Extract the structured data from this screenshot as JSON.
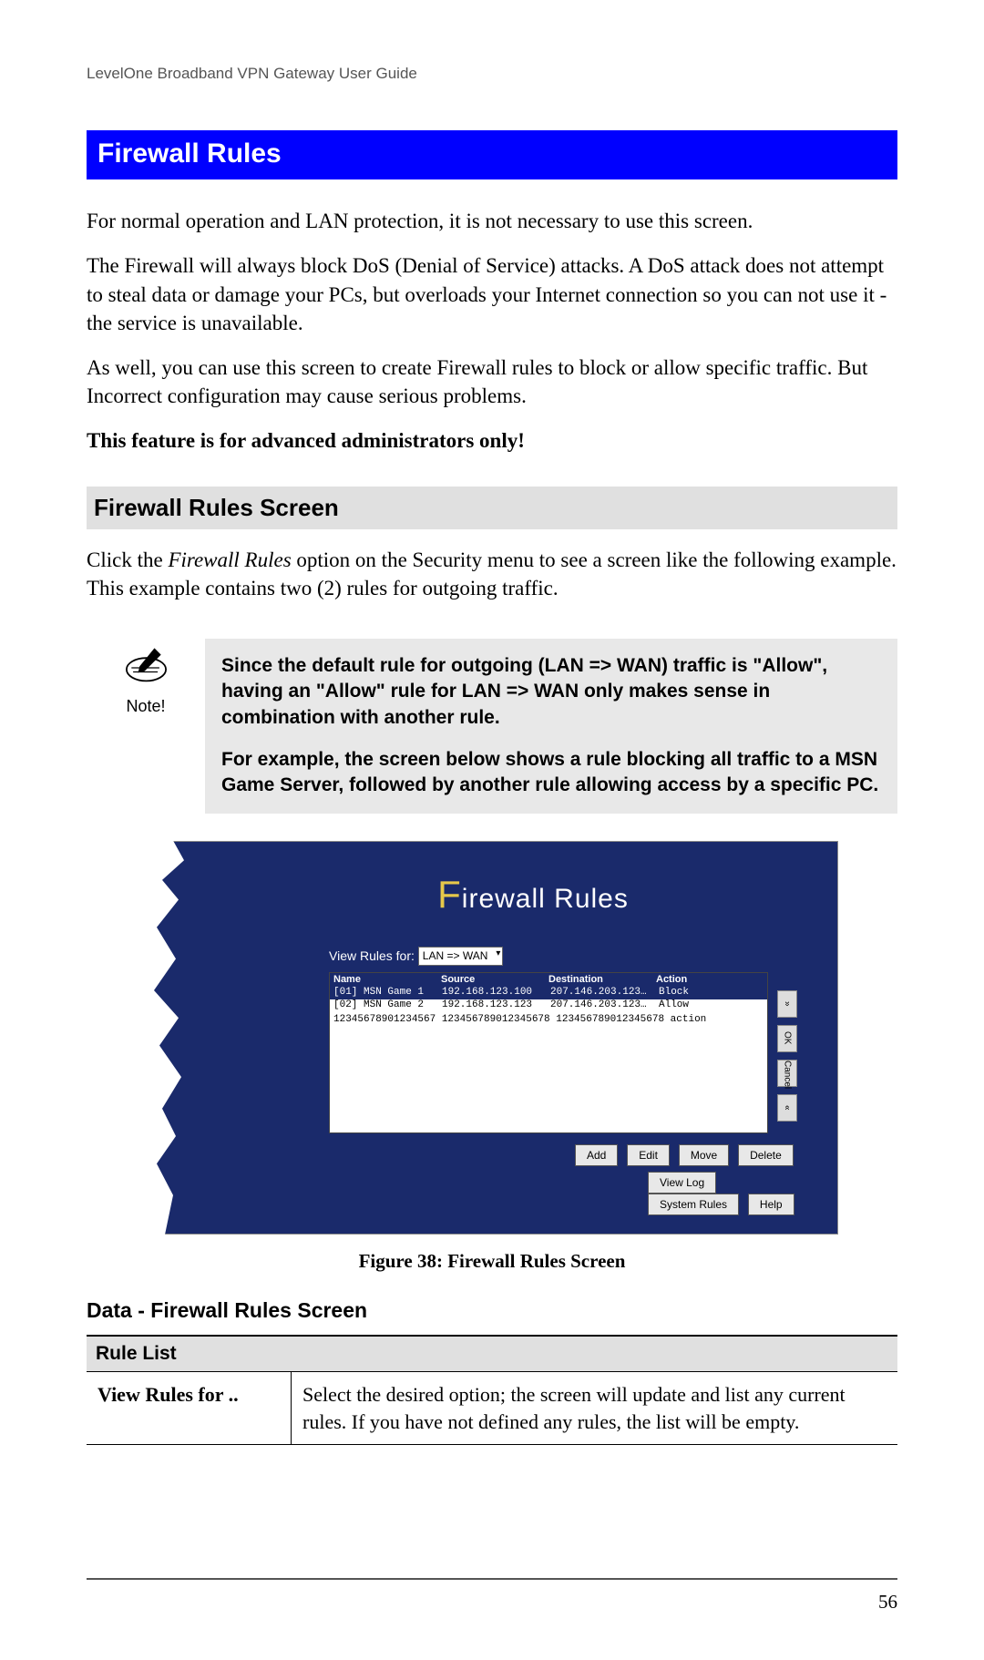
{
  "doc_header": "LevelOne Broadband VPN Gateway User Guide",
  "section_title": "Firewall Rules",
  "paragraphs": {
    "p1": "For normal operation and LAN protection, it is not necessary to use this screen.",
    "p2": "The Firewall will always block DoS (Denial of Service) attacks. A DoS attack does not attempt to steal data or damage your PCs, but overloads your Internet connection so you can not use it - the service is unavailable.",
    "p3": "As well, you can use this screen to create Firewall rules to block or allow specific traffic. But Incorrect configuration may cause serious problems.",
    "p4_bold": "This feature is for advanced administrators only!"
  },
  "subsection_title": "Firewall Rules Screen",
  "subsection_intro_pre": "Click the ",
  "subsection_intro_em": "Firewall Rules",
  "subsection_intro_post": " option on the Security menu to see a screen like the following example. This example contains two (2) rules for outgoing traffic.",
  "note": {
    "label": "Note!",
    "p1": "Since the default rule for outgoing (LAN => WAN) traffic is \"Allow\", having an \"Allow\" rule for LAN => WAN only makes sense in combination with another rule.",
    "p2": "For example, the screen below shows a rule blocking all traffic to a MSN Game Server, followed by another rule allowing access by a specific PC."
  },
  "fw_screen": {
    "title_rest": "irewall Rules",
    "view_rules_label": "View Rules for:",
    "view_rules_value": "LAN => WAN",
    "list_headers": [
      "Name",
      "Source",
      "Destination",
      "Action"
    ],
    "rows": [
      {
        "name": "[01] MSN Game 1",
        "source": "192.168.123.100",
        "dest": "207.146.203.123…",
        "action": "Block",
        "selected": true
      },
      {
        "name": "[02] MSN Game 2",
        "source": "192.168.123.123",
        "dest": "207.146.203.123…",
        "action": "Allow",
        "selected": false
      }
    ],
    "filler": "12345678901234567 123456789012345678 123456789012345678 action",
    "side_buttons": {
      "up": "»",
      "ok": "OK",
      "cancel": "Cancel",
      "down": "«"
    },
    "buttons_row1": [
      "Add",
      "Edit",
      "Move",
      "Delete"
    ],
    "buttons_row2": [
      "View Log",
      "System Rules",
      "Help"
    ]
  },
  "figure_caption": "Figure 38: Firewall Rules Screen",
  "data_heading": "Data - Firewall Rules Screen",
  "table": {
    "section_header": "Rule List",
    "row1_label": "View Rules for ..",
    "row1_desc": "Select the desired option; the screen will update and list any current rules. If you have not defined any rules, the list will be empty."
  },
  "page_number": "56"
}
